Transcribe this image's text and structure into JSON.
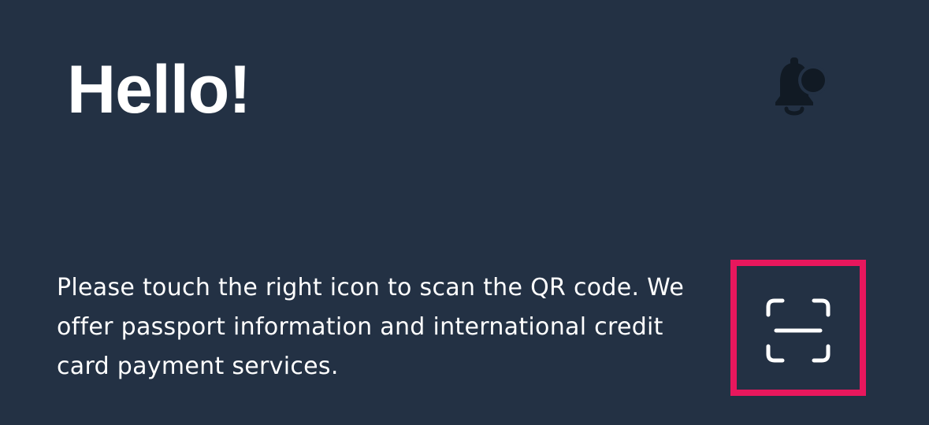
{
  "header": {
    "greeting": "Hello!",
    "notification_icon": "bell-icon"
  },
  "main": {
    "message": "Please touch the right icon to scan the QR code. We offer passport information and international credit card payment services.",
    "scan_icon": "qr-scan-icon"
  },
  "colors": {
    "background": "#233144",
    "text": "#ffffff",
    "highlight": "#e8175d",
    "bell": "#111a24"
  }
}
